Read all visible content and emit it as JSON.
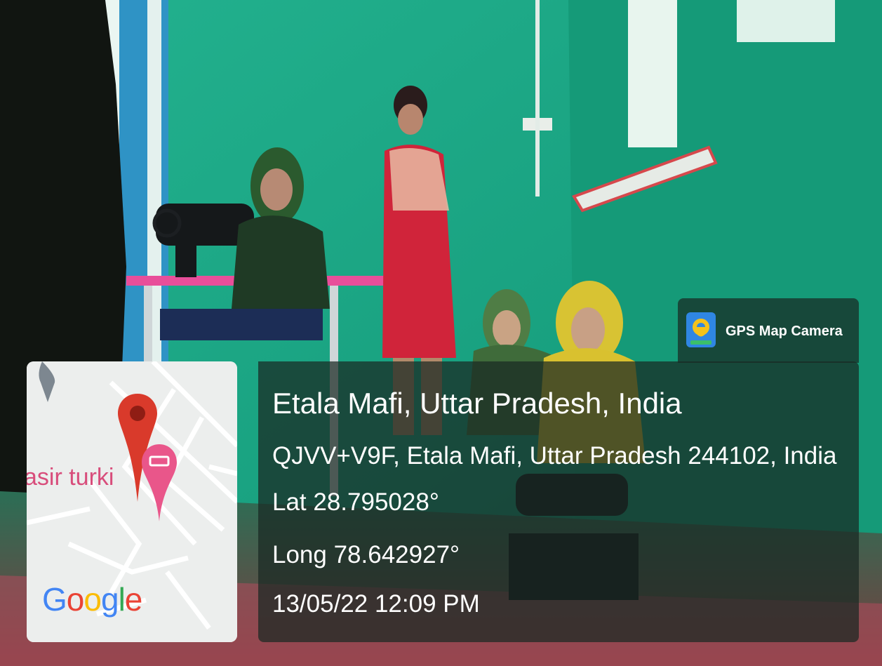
{
  "app": {
    "name": "GPS Map Camera",
    "icon": "gps-map-camera-icon"
  },
  "map": {
    "place_label": "asir turki",
    "logo": "Google",
    "pin_icon": "location-pin-icon",
    "marker_icon": "hotel-marker-icon"
  },
  "location": {
    "title": "Etala Mafi, Uttar Pradesh, India",
    "address": "QJVV+V9F, Etala Mafi, Uttar Pradesh 244102, India",
    "lat": "Lat 28.795028°",
    "long": "Long 78.642927°",
    "datetime": "13/05/22 12:09 PM"
  },
  "colors": {
    "overlay": "#19282380",
    "wall": "#1aa583",
    "pin_red": "#d93a2b",
    "marker_pink": "#e9568a"
  }
}
